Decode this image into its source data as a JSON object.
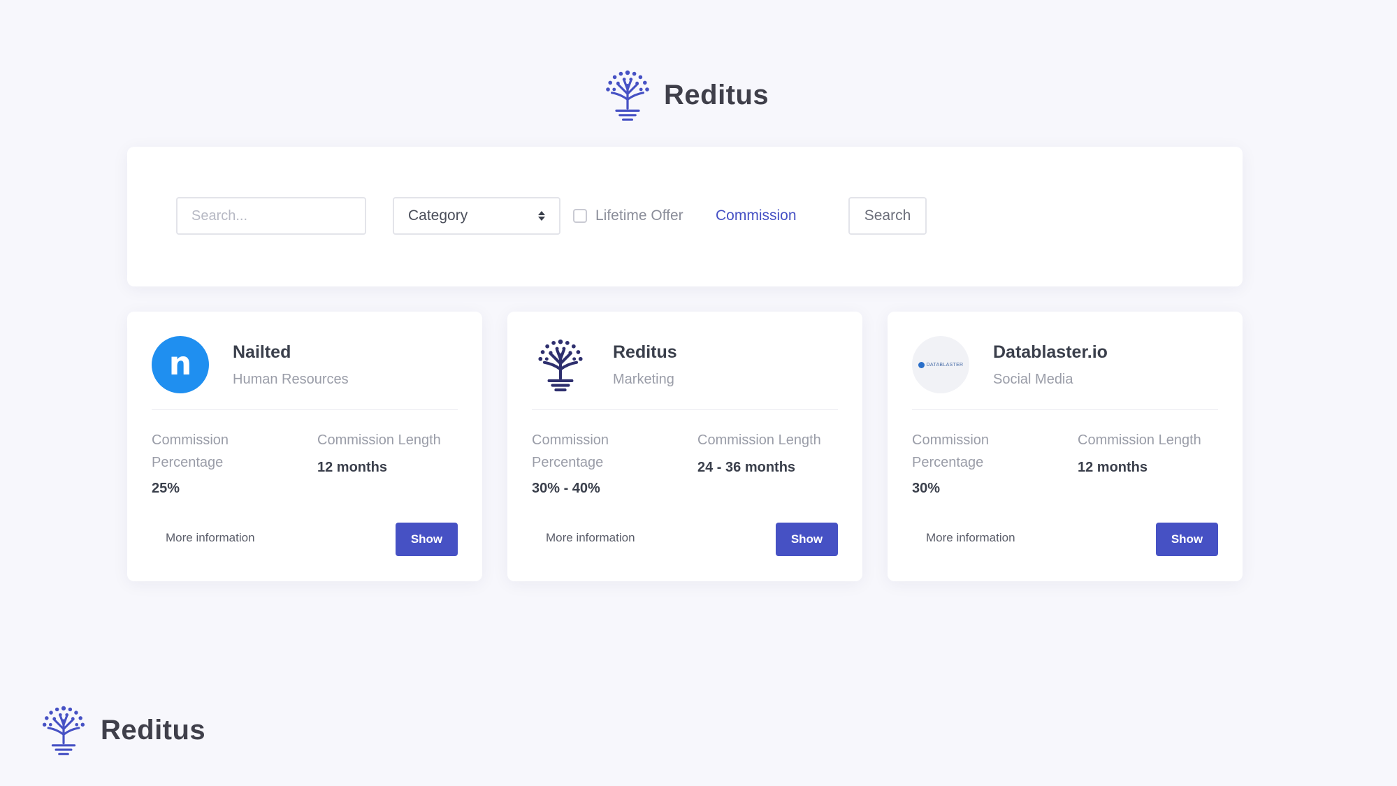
{
  "brand": {
    "name": "Reditus",
    "color": "#4651c4"
  },
  "filters": {
    "search_placeholder": "Search...",
    "category_label": "Category",
    "lifetime_label": "Lifetime Offer",
    "lifetime_checked": false,
    "commission_label": "Commission",
    "search_button": "Search"
  },
  "cards": [
    {
      "name": "Nailted",
      "category": "Human Resources",
      "logo_icon": "nailted-logo-icon",
      "logo_letter": "n",
      "commission_percentage_label": "Commission Percentage",
      "commission_percentage": "25%",
      "commission_length_label": "Commission Length",
      "commission_length": "12 months",
      "more_info": "More information",
      "show_button": "Show"
    },
    {
      "name": "Reditus",
      "category": "Marketing",
      "logo_icon": "reditus-tree-icon",
      "commission_percentage_label": "Commission Percentage",
      "commission_percentage": "30% - 40%",
      "commission_length_label": "Commission Length",
      "commission_length": "24 - 36 months",
      "more_info": "More information",
      "show_button": "Show"
    },
    {
      "name": "Datablaster.io",
      "category": "Social Media",
      "logo_icon": "datablaster-logo-icon",
      "logo_text": "DATABLASTER",
      "commission_percentage_label": "Commission Percentage",
      "commission_percentage": "30%",
      "commission_length_label": "Commission Length",
      "commission_length": "12 months",
      "more_info": "More information",
      "show_button": "Show"
    }
  ],
  "footer": {
    "brand_name": "Reditus"
  }
}
